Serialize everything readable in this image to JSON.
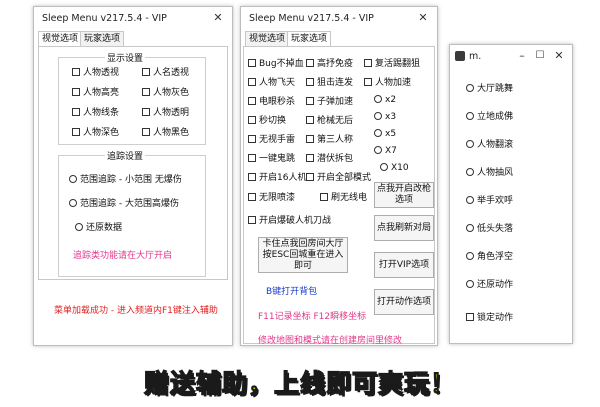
{
  "colors": {
    "pink": "#e0388a",
    "red": "#e02020",
    "blue": "#1a3cc8",
    "banner": "#ffe600"
  },
  "window1": {
    "title": "Sleep Menu v217.5.4 - VIP",
    "tabs": [
      "视觉选项",
      "玩家选项"
    ],
    "display_group": {
      "title": "显示设置",
      "items": [
        "人物透视",
        "人名透视",
        "人物高亮",
        "人物灰色",
        "人物线条",
        "人物透明",
        "人物深色",
        "人物黑色"
      ]
    },
    "trace_group": {
      "title": "追踪设置",
      "items": [
        "范围追踪 - 小范围 无爆伤",
        "范围追踪 - 大范围高爆伤",
        "还原数据"
      ],
      "hint": "追踪类功能请在大厅开启"
    },
    "status": "菜单加载成功 - 进入频道内F1键注入辅助"
  },
  "window2": {
    "title": "Sleep Menu v217.5.4 - VIP",
    "tabs": [
      "视觉选项",
      "玩家选项"
    ],
    "col1": [
      "Bug不掉血",
      "人物飞天",
      "电眼秒杀",
      "秒切换",
      "无视手雷",
      "一键鬼跳",
      "开启16人机",
      "无限喷漆",
      "开启爆破人机刀战"
    ],
    "col2": [
      "高抒免疫",
      "狙击连发",
      "子弹加速",
      "枪械无后",
      "第三人称",
      "潜伏拆包",
      "开启全部模式",
      "刷无线电"
    ],
    "col3": [
      "复活踢翻狙",
      "人物加速"
    ],
    "speeds": [
      "x2",
      "x3",
      "x5",
      "X7",
      "X10"
    ],
    "buttons": {
      "room": "卡住点我回房间大厅按ESC回城重在进入即可",
      "weapon": "点我开启改枪选项",
      "refresh": "点我刷新对局",
      "vip": "打开VIP选项",
      "action": "打开动作选项"
    },
    "b_key": "B键打开背包",
    "coords": "F11记录坐标  F12瞬移坐标",
    "hint": "修改地图和模式请在创建房间里修改"
  },
  "window3": {
    "title": "m.",
    "items": [
      "大厅跳舞",
      "立地成佛",
      "人物翻滚",
      "人物抽风",
      "举手欢呼",
      "低头失落",
      "角色浮空",
      "还原动作"
    ],
    "lock": "锁定动作"
  },
  "banner": "赠送辅助，上线即可爽玩！"
}
